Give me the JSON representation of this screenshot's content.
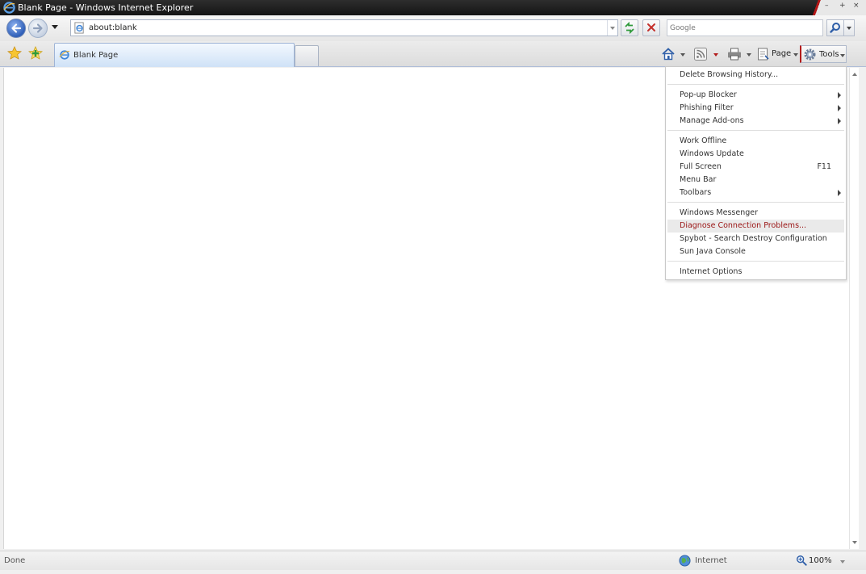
{
  "window": {
    "title": "Blank Page - Windows Internet Explorer"
  },
  "navigation": {
    "address_url": "about:blank",
    "search_placeholder": "Google"
  },
  "tabs": [
    {
      "label": "Blank Page",
      "active": true
    }
  ],
  "command_bar": {
    "page_label": "Page",
    "tools_label": "Tools"
  },
  "tools_menu": {
    "items": [
      {
        "label": "Delete Browsing History..."
      },
      {
        "label": "Pop-up Blocker",
        "submenu": true
      },
      {
        "label": "Phishing Filter",
        "submenu": true
      },
      {
        "label": "Manage Add-ons",
        "submenu": true
      },
      {
        "label": "Work Offline"
      },
      {
        "label": "Windows Update"
      },
      {
        "label": "Full Screen",
        "shortcut": "F11"
      },
      {
        "label": "Menu Bar"
      },
      {
        "label": "Toolbars",
        "submenu": true
      },
      {
        "label": "Windows Messenger"
      },
      {
        "label": "Diagnose Connection Problems...",
        "highlighted": true
      },
      {
        "label": "Spybot - Search  Destroy Configuration"
      },
      {
        "label": "Sun Java Console"
      },
      {
        "label": "Internet Options"
      }
    ]
  },
  "status_bar": {
    "status_text": "Done",
    "zone_label": "Internet",
    "zoom_label": "100%"
  },
  "colors": {
    "title_bar": "#1f1f1f",
    "accent_red": "#b31c1c",
    "highlight_text": "#9a1414",
    "tab_active": "#cfe2f7"
  },
  "icons": [
    "ie-logo-icon",
    "back-arrow-icon",
    "forward-arrow-icon",
    "page-icon",
    "refresh-icon",
    "stop-icon",
    "search-icon",
    "favorites-star-icon",
    "add-favorites-icon",
    "home-icon",
    "feeds-icon",
    "print-icon",
    "page-menu-icon",
    "tools-gear-icon",
    "globe-icon",
    "zoom-icon"
  ]
}
